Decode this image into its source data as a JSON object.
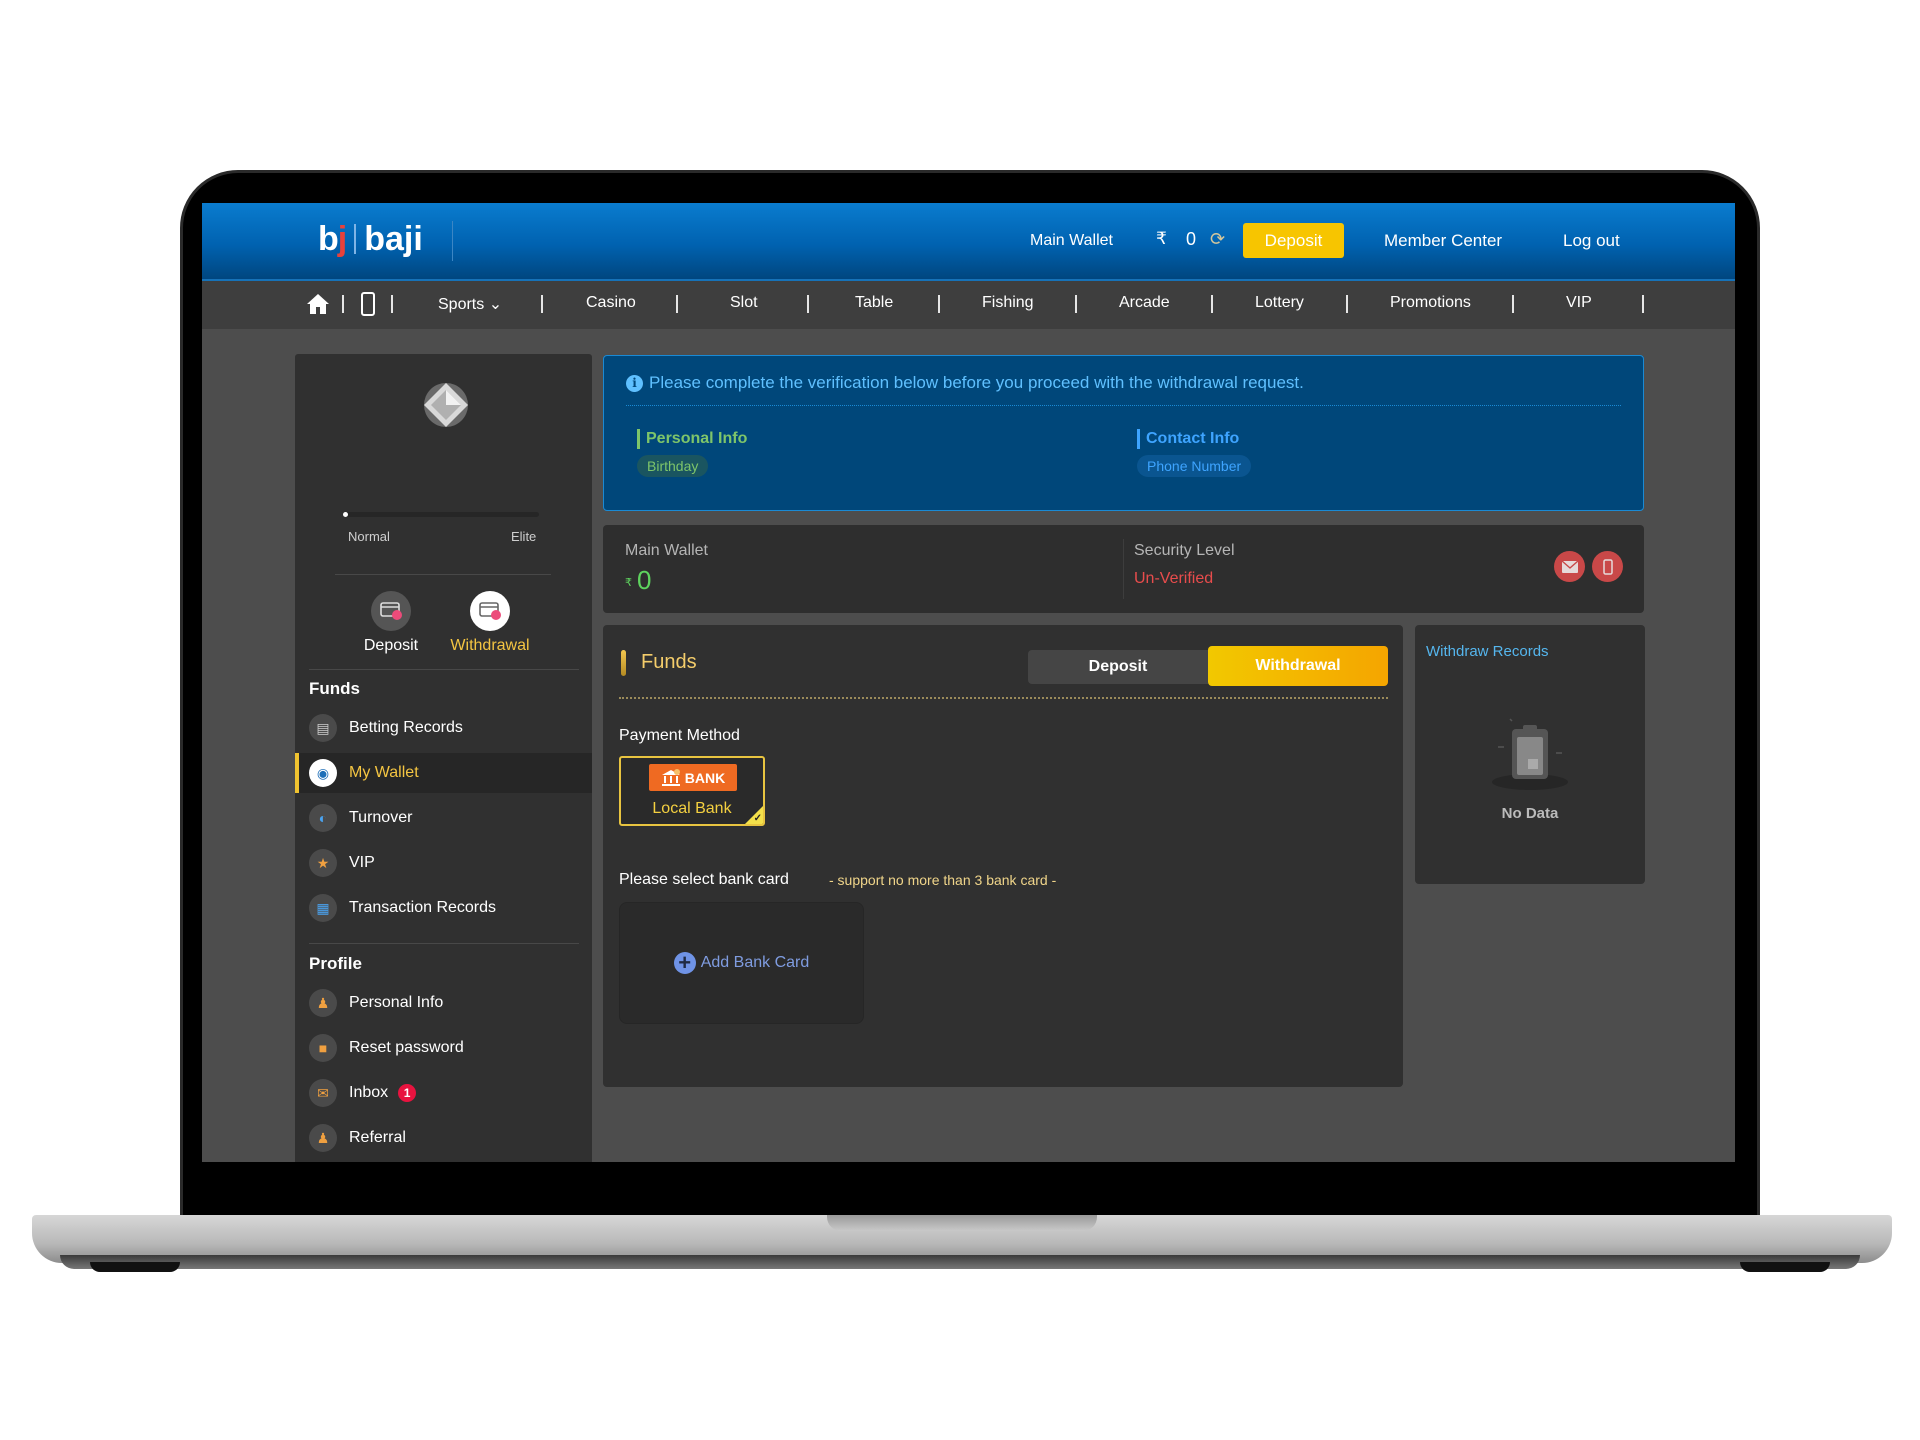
{
  "header": {
    "logo_short": "bj",
    "logo_name": "baji",
    "wallet_label": "Main Wallet",
    "currency_symbol": "₹",
    "balance": "0",
    "deposit_label": "Deposit",
    "member_center_label": "Member Center",
    "logout_label": "Log out",
    "colors": {
      "header_blue": "#0062b0",
      "deposit_yellow": "#f7c500"
    }
  },
  "nav": {
    "icons": [
      "home-icon",
      "mobile-icon"
    ],
    "items": [
      {
        "label": "Sports",
        "dropdown": true
      },
      {
        "label": "Casino"
      },
      {
        "label": "Slot"
      },
      {
        "label": "Table"
      },
      {
        "label": "Fishing"
      },
      {
        "label": "Arcade"
      },
      {
        "label": "Lottery"
      },
      {
        "label": "Promotions"
      },
      {
        "label": "VIP"
      }
    ]
  },
  "sidebar": {
    "vip_icon": "diamond-badge-icon",
    "level_progress_percent": 0,
    "level_from": "Normal",
    "level_to": "Elite",
    "quick_actions": [
      {
        "label": "Deposit",
        "icon": "deposit-card-icon",
        "active": false
      },
      {
        "label": "Withdrawal",
        "icon": "withdrawal-card-icon",
        "active": true
      }
    ],
    "funds_title": "Funds",
    "funds_items": [
      {
        "label": "Betting Records",
        "icon": "clipboard-icon",
        "active": false
      },
      {
        "label": "My Wallet",
        "icon": "wallet-icon",
        "active": true
      },
      {
        "label": "Turnover",
        "icon": "turnover-icon",
        "active": false
      },
      {
        "label": "VIP",
        "icon": "vip-star-icon",
        "active": false
      },
      {
        "label": "Transaction Records",
        "icon": "transaction-icon",
        "active": false
      }
    ],
    "profile_title": "Profile",
    "profile_items": [
      {
        "label": "Personal Info",
        "icon": "user-icon"
      },
      {
        "label": "Reset password",
        "icon": "lock-icon"
      },
      {
        "label": "Inbox",
        "icon": "mail-icon",
        "badge": "1"
      },
      {
        "label": "Referral",
        "icon": "referral-icon"
      }
    ],
    "accent_color": "#f0c330"
  },
  "verification": {
    "message": "Please complete the verification below before you proceed with the withdrawal request.",
    "groups": [
      {
        "title": "Personal Info",
        "chip": "Birthday",
        "color": "#7ec56a"
      },
      {
        "title": "Contact Info",
        "chip": "Phone Number",
        "color": "#3ea4ff"
      }
    ]
  },
  "wallet_panel": {
    "label": "Main Wallet",
    "currency_symbol": "₹",
    "amount": "0",
    "security_label": "Security Level",
    "security_status": "Un-Verified",
    "status_color": "#e84c4c",
    "verify_icons": [
      "email-icon",
      "phone-icon"
    ]
  },
  "funds": {
    "title": "Funds",
    "tabs": [
      {
        "label": "Deposit",
        "active": false
      },
      {
        "label": "Withdrawal",
        "active": true
      }
    ],
    "payment_method_label": "Payment Method",
    "payment_methods": [
      {
        "logo_text": "BANK",
        "name": "Local Bank",
        "selected": true
      }
    ],
    "bank_card_label": "Please select bank card",
    "bank_card_note": "- support no more than 3 bank card -",
    "add_card_label": "Add Bank Card"
  },
  "records": {
    "title": "Withdraw Records",
    "empty_label": "No Data"
  }
}
